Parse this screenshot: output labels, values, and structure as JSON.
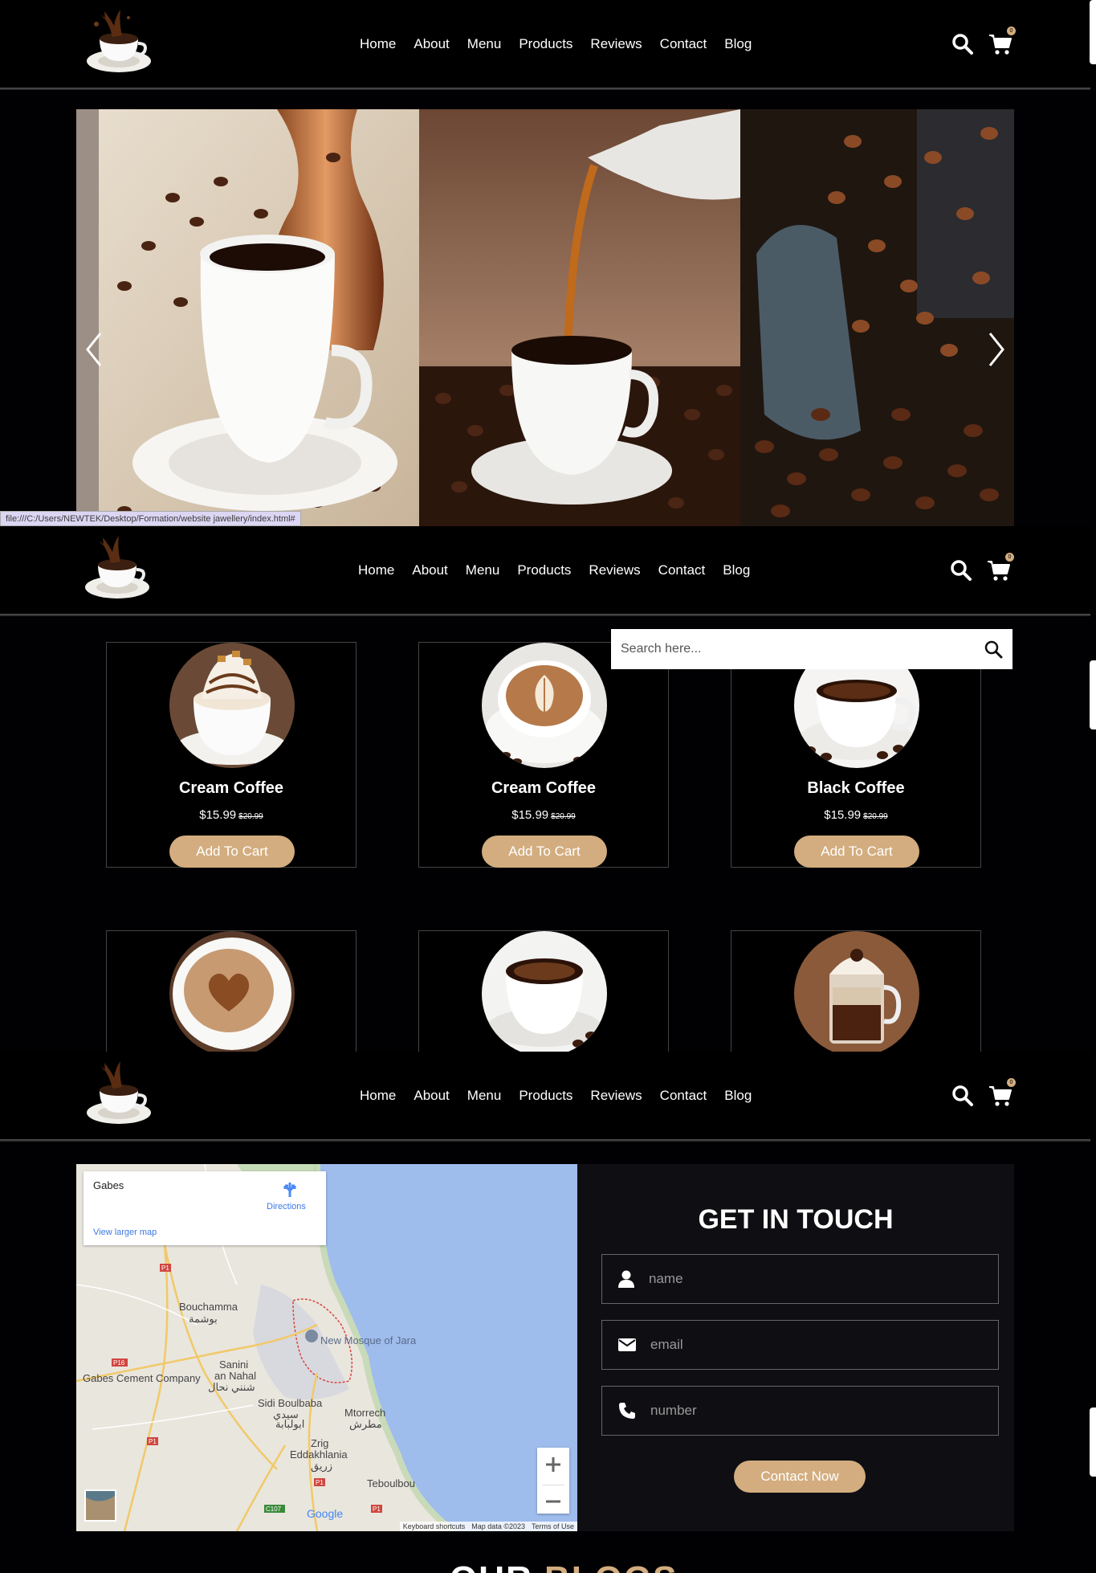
{
  "nav": {
    "items": [
      "Home",
      "About",
      "Menu",
      "Products",
      "Reviews",
      "Contact",
      "Blog"
    ],
    "cart_count": "0"
  },
  "status_url": "file:///C:/Users/NEWTEK/Desktop/Formation/website jawellery/index.html#",
  "search": {
    "placeholder": "Search here..."
  },
  "products": [
    {
      "name": "Cream Coffee",
      "price": "$15.99",
      "old_price": "$20.99",
      "cta": "Add To Cart",
      "photo": "cream-coffee"
    },
    {
      "name": "Cream Coffee",
      "price": "$15.99",
      "old_price": "$20.99",
      "cta": "Add To Cart",
      "photo": "latte-art"
    },
    {
      "name": "Black Coffee",
      "price": "$15.99",
      "old_price": "$20.99",
      "cta": "Add To Cart",
      "photo": "black-coffee"
    }
  ],
  "products_row2": [
    "heart-latte",
    "espresso-cup",
    "mocha-glass"
  ],
  "map": {
    "place": "Gabes",
    "directions": "Directions",
    "larger_map": "View larger map",
    "labels": {
      "bouchamma": "Bouchamma",
      "bouchamma_ar": "بوشمة",
      "mosque": "New Mosque of Jara",
      "sanini": "Sanini",
      "an_nahal": "an Nahal",
      "sanini_ar": "شنني نحال",
      "cement": "Gabes Cement Company",
      "sidi": "Sidi Boulbaba",
      "sidi_ar": "سيدي",
      "sidi_ar2": "ابولبابة",
      "mtorrech": "Mtorrech",
      "mtorrech_ar": "مطرش",
      "zrig": "Zrig",
      "eddakhlania": "Eddakhlania",
      "zrig_ar": "زريق",
      "teboulbou": "Teboulbou",
      "p1": "P1",
      "p16": "P16",
      "c107": "C107",
      "google": "Google"
    },
    "footer": [
      "Keyboard shortcuts",
      "Map data ©2023",
      "Terms of Use"
    ]
  },
  "contact": {
    "title": "GET IN TOUCH",
    "name_placeholder": "name",
    "email_placeholder": "email",
    "number_placeholder": "number",
    "cta": "Contact Now"
  },
  "blogs": {
    "word1": "OUR",
    "word2": "BLOGS"
  }
}
